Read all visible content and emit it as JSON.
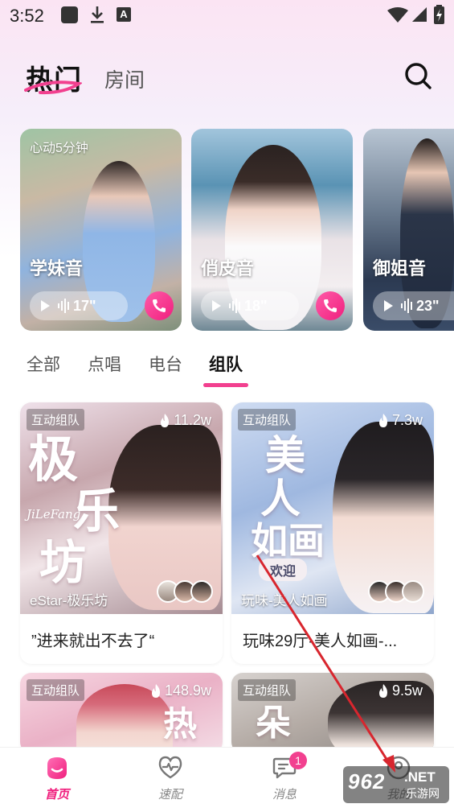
{
  "status_bar": {
    "time": "3:52",
    "badge_letter": "A"
  },
  "header": {
    "tab_hot": "热门",
    "tab_room": "房间"
  },
  "voice_cards": [
    {
      "tag": "心动5分钟",
      "name": "学妹音",
      "duration": "17\""
    },
    {
      "tag": "",
      "name": "俏皮音",
      "duration": "18\""
    },
    {
      "tag": "",
      "name": "御姐音",
      "duration": "23\""
    }
  ],
  "sub_tabs": [
    "全部",
    "点唱",
    "电台",
    "组队"
  ],
  "rooms": [
    {
      "badge": "互动组队",
      "heat": "11.2w",
      "overlay": "eStar-极乐坊",
      "title": "”进来就出不去了“",
      "cover_text": [
        "极",
        "乐",
        "坊"
      ],
      "cover_sub": "JiLeFang"
    },
    {
      "badge": "互动组队",
      "heat": "7.3w",
      "overlay": "玩味-美人如画",
      "title": "玩味29厅-美人如画-...",
      "cover_text": [
        "美",
        "人",
        "如画"
      ],
      "cover_sub": "欢迎"
    },
    {
      "badge": "互动组队",
      "heat": "148.9w",
      "cover_text": [
        "热"
      ]
    },
    {
      "badge": "互动组队",
      "heat": "9.5w",
      "cover_text": [
        "朵"
      ]
    }
  ],
  "bottom_nav": {
    "home": "首页",
    "match": "速配",
    "messages": "消息",
    "messages_badge": "1",
    "me": "我的"
  },
  "watermark": {
    "logo": "962",
    "net": ".NET",
    "sub": "乐游网"
  },
  "colors": {
    "accent": "#f2408f",
    "accent_dark": "#f0207e"
  }
}
